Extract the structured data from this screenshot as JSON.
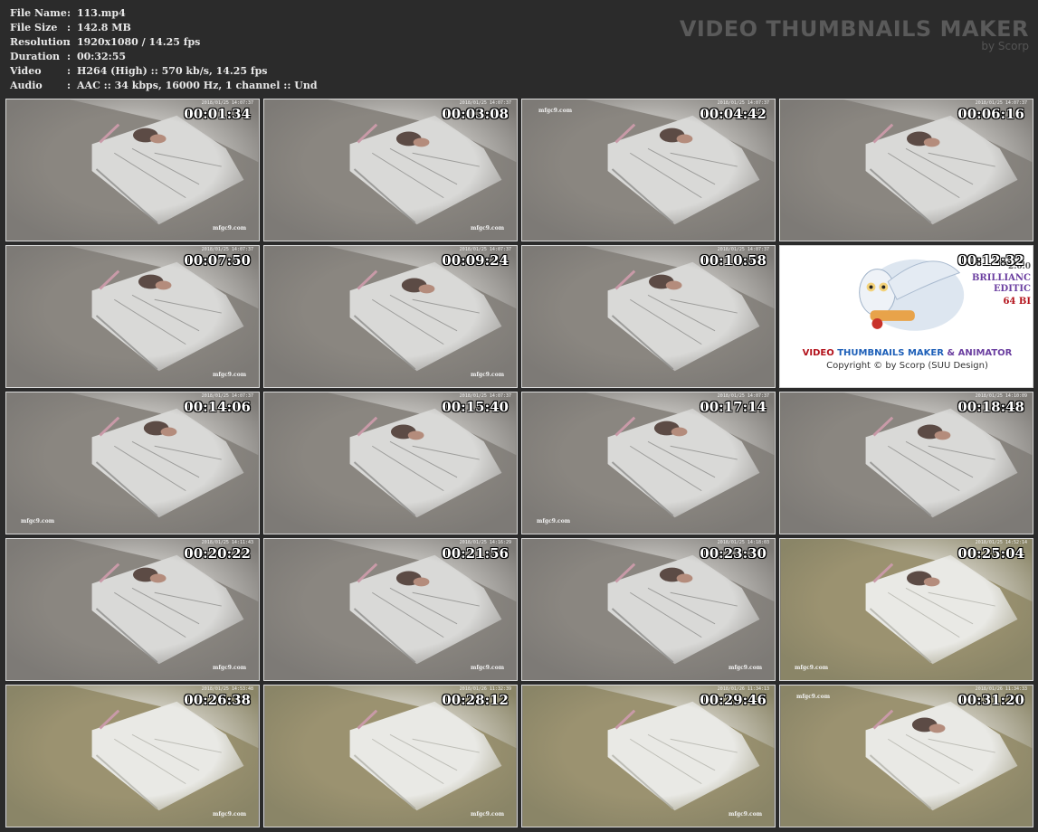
{
  "header": {
    "info": [
      {
        "label": "File Name",
        "value": "113.mp4"
      },
      {
        "label": "File Size",
        "value": "142.8 MB"
      },
      {
        "label": "Resolution",
        "value": "1920x1080 / 14.25 fps"
      },
      {
        "label": "Duration",
        "value": "00:32:55"
      },
      {
        "label": "Video",
        "value": "H264 (High) :: 570 kb/s, 14.25 fps"
      },
      {
        "label": "Audio",
        "value": "AAC :: 34 kbps, 16000 Hz, 1 channel :: Und"
      }
    ],
    "separator": ":",
    "brand_title": "VIDEO THUMBNAILS MAKER",
    "brand_sub": "by Scorp"
  },
  "thumbnails": [
    {
      "time": "00:01:34",
      "date": "2018/01/25 14:07:37",
      "watermark": "mfgc9.com",
      "wm_side": "left",
      "tone": "dark",
      "has_person": true
    },
    {
      "time": "00:03:08",
      "date": "2018/01/25 14:07:37",
      "watermark": "mfgc9.com",
      "wm_side": "left",
      "tone": "dark",
      "has_person": true
    },
    {
      "time": "00:04:42",
      "date": "2018/01/25 14:07:37",
      "watermark": "mfgc9.com",
      "wm_side": "topleft",
      "tone": "dark",
      "has_person": true
    },
    {
      "time": "00:06:16",
      "date": "2018/01/25 14:07:37",
      "watermark": "",
      "wm_side": "none",
      "tone": "dark",
      "has_person": true
    },
    {
      "time": "00:07:50",
      "date": "2018/01/25 14:07:37",
      "watermark": "mfgc9.com",
      "wm_side": "left",
      "tone": "dark",
      "has_person": true
    },
    {
      "time": "00:09:24",
      "date": "2018/01/25 14:07:37",
      "watermark": "mfgc9.com",
      "wm_side": "left",
      "tone": "dark",
      "has_person": true
    },
    {
      "time": "00:10:58",
      "date": "2018/01/25 14:07:37",
      "watermark": "",
      "wm_side": "none",
      "tone": "dark",
      "has_person": true
    },
    {
      "time": "00:12:32",
      "date": "",
      "watermark": "",
      "wm_side": "none",
      "tone": "ad",
      "has_person": false
    },
    {
      "time": "00:14:06",
      "date": "2018/01/25 14:07:37",
      "watermark": "mfgc9.com",
      "wm_side": "bottomleft",
      "tone": "dark",
      "has_person": true
    },
    {
      "time": "00:15:40",
      "date": "2018/01/25 14:07:37",
      "watermark": "",
      "wm_side": "none",
      "tone": "dark",
      "has_person": true
    },
    {
      "time": "00:17:14",
      "date": "2018/01/25 14:07:37",
      "watermark": "mfgc9.com",
      "wm_side": "bottomleft",
      "tone": "dark",
      "has_person": true
    },
    {
      "time": "00:18:48",
      "date": "2018/01/25 14:10:09",
      "watermark": "",
      "wm_side": "none",
      "tone": "dark",
      "has_person": true
    },
    {
      "time": "00:20:22",
      "date": "2018/01/25 14:11:43",
      "watermark": "mfgc9.com",
      "wm_side": "left",
      "tone": "dark",
      "has_person": true
    },
    {
      "time": "00:21:56",
      "date": "2018/01/25 14:16:29",
      "watermark": "mfgc9.com",
      "wm_side": "left",
      "tone": "dark",
      "has_person": true
    },
    {
      "time": "00:23:30",
      "date": "2018/01/25 14:18:03",
      "watermark": "mfgc9.com",
      "wm_side": "left",
      "tone": "dark",
      "has_person": true
    },
    {
      "time": "00:25:04",
      "date": "2018/01/25 14:52:14",
      "watermark": "mfgc9.com",
      "wm_side": "bottomleft",
      "tone": "warm",
      "has_person": true
    },
    {
      "time": "00:26:38",
      "date": "2018/01/25 14:53:48",
      "watermark": "mfgc9.com",
      "wm_side": "left",
      "tone": "warm",
      "has_person": false
    },
    {
      "time": "00:28:12",
      "date": "2018/01/26 11:32:39",
      "watermark": "mfgc9.com",
      "wm_side": "left",
      "tone": "warm",
      "has_person": false
    },
    {
      "time": "00:29:46",
      "date": "2018/01/26 11:34:13",
      "watermark": "mfgc9.com",
      "wm_side": "left",
      "tone": "warm",
      "has_person": false
    },
    {
      "time": "00:31:20",
      "date": "2018/01/26 11:34:33",
      "watermark": "mfgc9.com",
      "wm_side": "topleft",
      "tone": "warm",
      "has_person": true
    }
  ],
  "ad": {
    "line1_a": "VIDEO ",
    "line1_b": "THUMBNAILS MAKER",
    "line1_c": " & ANIMATOR",
    "line2": "Copyright © by Scorp (SUU Design)",
    "side1": "2.0.0",
    "side2": "BRILLIANC",
    "side3": "EDITIC",
    "side4": "64 BI",
    "colors": {
      "red": "#b3121b",
      "blue": "#1d5fb8",
      "purple": "#6b3fa0"
    }
  }
}
